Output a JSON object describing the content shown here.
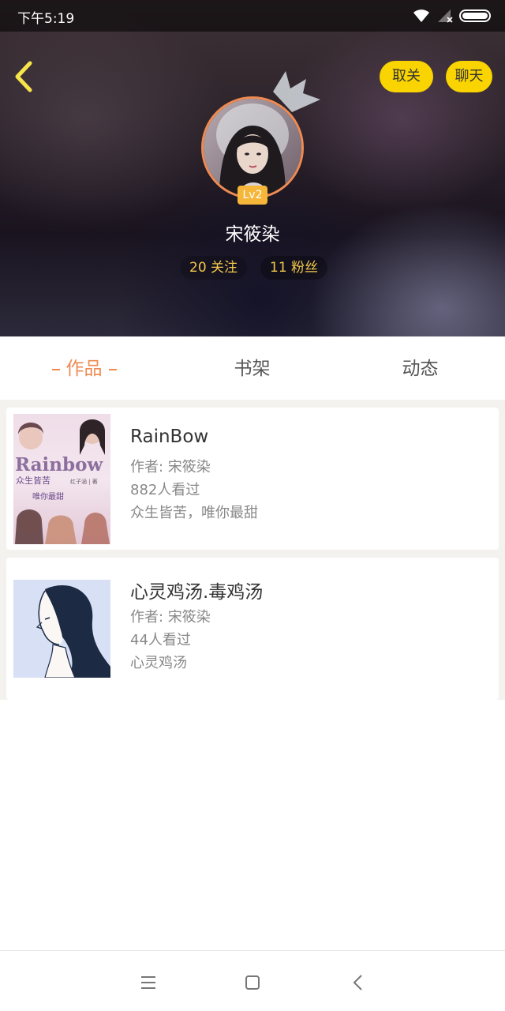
{
  "status_bar": {
    "time": "下午5:19"
  },
  "header": {
    "unfollow_label": "取关",
    "chat_label": "聊天"
  },
  "profile": {
    "level": "Lv2",
    "name": "宋筱染",
    "following": "20 关注",
    "fans": "11 粉丝"
  },
  "tabs": [
    {
      "label": "作品",
      "active": true
    },
    {
      "label": "书架",
      "active": false
    },
    {
      "label": "动态",
      "active": false
    }
  ],
  "books": [
    {
      "title": "RainBow",
      "author": "作者: 宋筱染",
      "views": "882人看过",
      "summary": "众生皆苦，唯你最甜",
      "cover_text": {
        "title": "Rainbow",
        "sub": "众生皆苦",
        "tag": "唯你最甜",
        "author": "红子涵 | 著"
      }
    },
    {
      "title": "心灵鸡汤.毒鸡汤",
      "author": "作者: 宋筱染",
      "views": "44人看过",
      "summary": "心灵鸡汤"
    }
  ],
  "colors": {
    "accent": "#f08a52",
    "pill": "#f9d400",
    "stat": "#f2c84a",
    "badge": "#f6b63a"
  },
  "icons": [
    "wifi-icon",
    "signal-icon",
    "battery-icon",
    "back-arrow-icon",
    "crown-icon",
    "menu-icon",
    "home-icon",
    "nav-back-icon"
  ]
}
